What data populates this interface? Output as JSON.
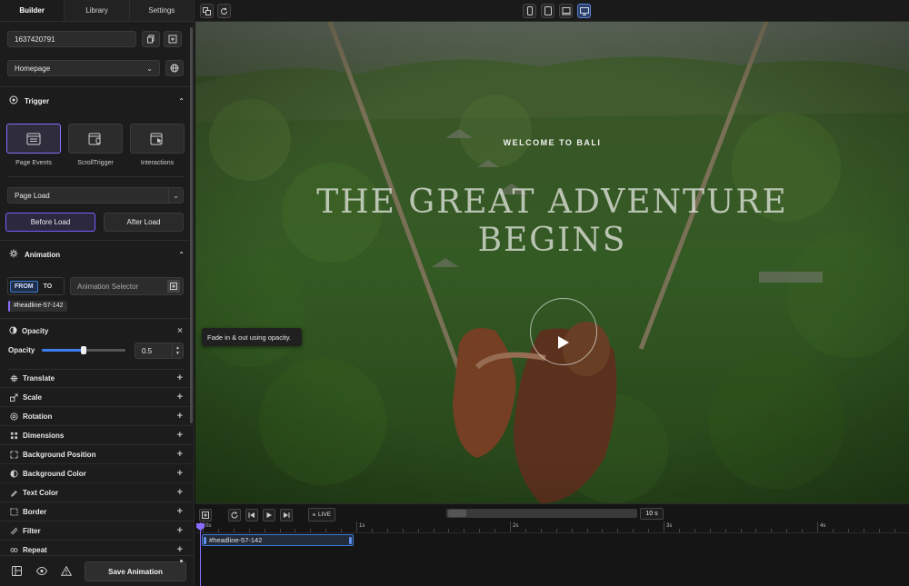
{
  "tabs": [
    "Builder",
    "Library",
    "Settings"
  ],
  "id_value": "1637420791",
  "page_select": "Homepage",
  "trigger": {
    "title": "Trigger",
    "cards": [
      "Page Events",
      "ScrollTrigger",
      "Interactions"
    ],
    "event_select": "Page Load",
    "before_label": "Before Load",
    "after_label": "After Load"
  },
  "animation": {
    "title": "Animation",
    "from_label": "FROM",
    "to_label": "TO",
    "selector_placeholder": "Animation Selector",
    "tag": "#headline-57-142",
    "opacity_title": "Opacity",
    "opacity_label": "Opacity",
    "opacity_value": "0.5",
    "opacity_level": 0.5,
    "tooltip": "Fade in & out using opacity.",
    "properties": [
      "Translate",
      "Scale",
      "Rotation",
      "Dimensions",
      "Background Position",
      "Background Color",
      "Text Color",
      "Border",
      "Filter",
      "Repeat"
    ]
  },
  "save_label": "Save Animation",
  "hero": {
    "kicker": "WELCOME TO BALI",
    "headline_1": "THE GREAT ADVENTURE",
    "headline_2": "BEGINS"
  },
  "timeline": {
    "live_label": "LIVE",
    "duration": "10 s",
    "ticks": [
      "0s",
      "1s",
      "2s",
      "3s",
      "4s"
    ],
    "track_label": "#headline-57-142"
  },
  "colors": {
    "accent": "#7c5cff",
    "panel": "#1c1c1c"
  }
}
